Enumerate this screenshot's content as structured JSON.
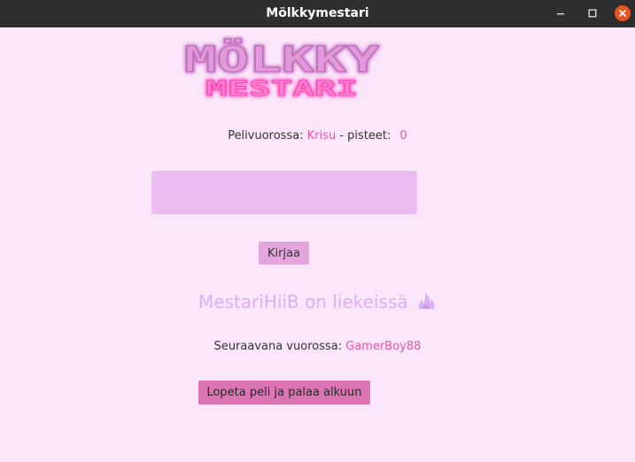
{
  "window": {
    "title": "Mölkkymestari"
  },
  "logo": {
    "line1": "MÖLKKY",
    "line2": "MESTARI"
  },
  "turn": {
    "label": "Pelivuorossa:",
    "player": "Krisu",
    "separator": "- pisteet:",
    "points": "0"
  },
  "score_input": {
    "value": "",
    "placeholder": ""
  },
  "record_button": {
    "label": "Kirjaa"
  },
  "status": {
    "message": "MestariHiiB on liekeissä",
    "icon": "fire-icon"
  },
  "next_turn": {
    "label": "Seuraavana vuorossa:",
    "player": "GamerBoy88"
  },
  "quit_button": {
    "label": "Lopeta peli ja palaa alkuun"
  },
  "colors": {
    "background": "#fce6fc",
    "accent": "#e35aa2",
    "input_bg": "#ecbcf0",
    "record_button_bg": "#e3a6dc",
    "quit_button_bg": "#dc74b4",
    "status_text": "#d8b2f4",
    "titlebar": "#2e2e2e",
    "close_button": "#e95420"
  }
}
